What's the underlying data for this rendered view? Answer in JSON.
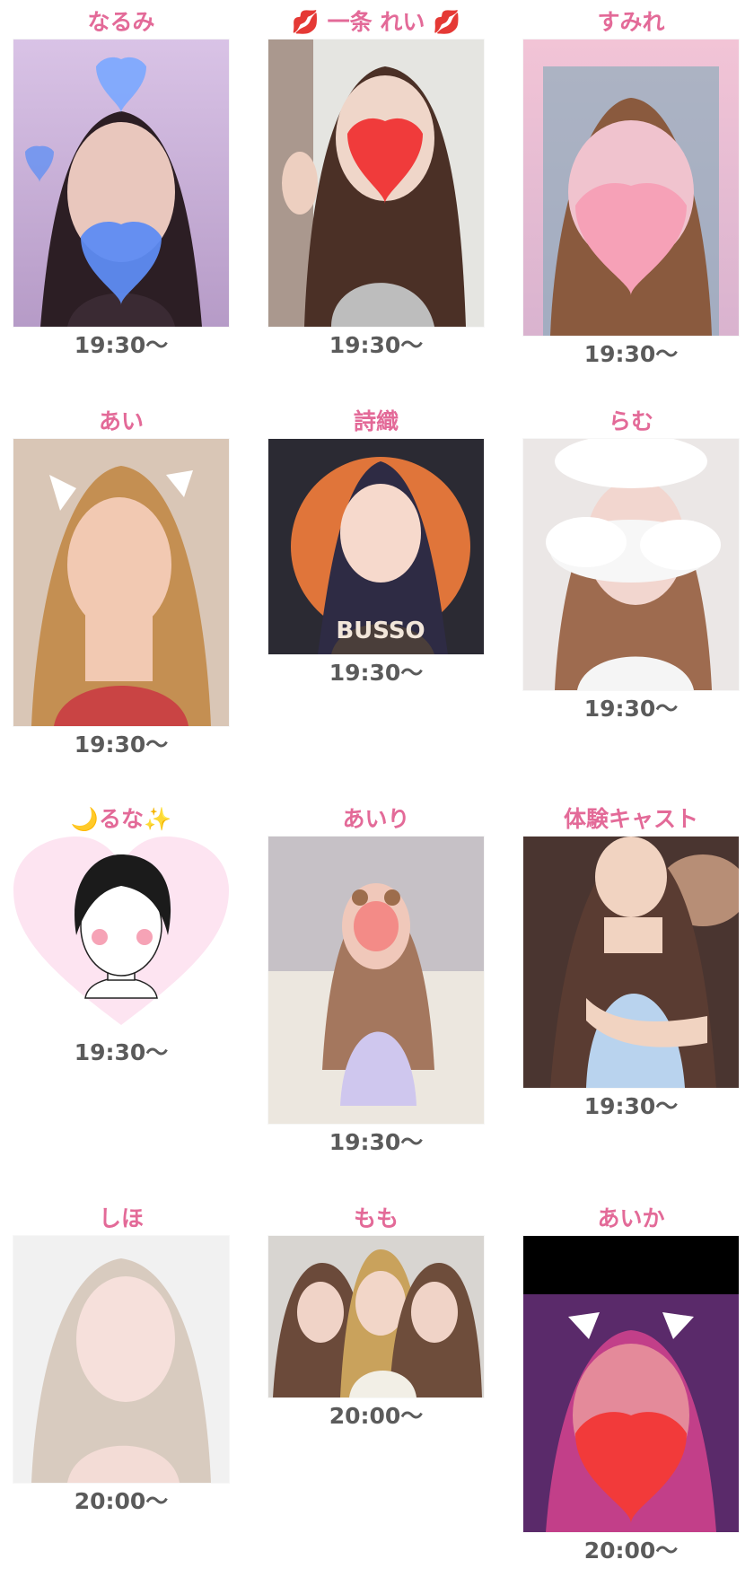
{
  "casts": [
    {
      "name": "なるみ",
      "time": "19:30〜"
    },
    {
      "name": "💋 一条 れい 💋",
      "time": "19:30〜"
    },
    {
      "name": "すみれ",
      "time": "19:30〜"
    },
    {
      "name": "あい",
      "time": "19:30〜"
    },
    {
      "name": "詩織",
      "time": "19:30〜",
      "photo_text": "BUSSO"
    },
    {
      "name": "らむ",
      "time": "19:30〜"
    },
    {
      "name": "🌙るな✨",
      "time": "19:30〜"
    },
    {
      "name": "あいり",
      "time": "19:30〜"
    },
    {
      "name": "体験キャスト",
      "time": "19:30〜"
    },
    {
      "name": "しほ",
      "time": "20:00〜"
    },
    {
      "name": "もも",
      "time": "20:00〜"
    },
    {
      "name": "あいか",
      "time": "20:00〜"
    }
  ],
  "colors": {
    "name": "#e36a98",
    "time": "#5b5b5b"
  }
}
